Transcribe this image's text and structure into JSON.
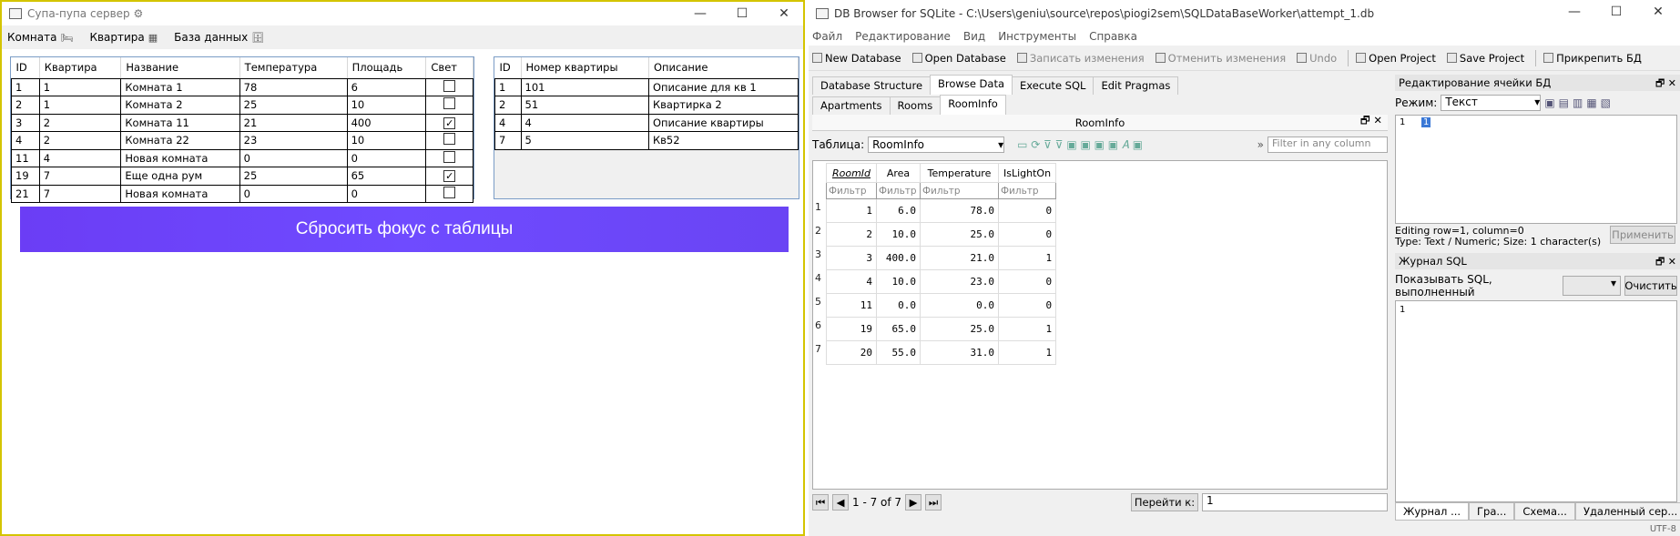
{
  "wpf": {
    "title": "Супа-пупа сервер ⚙",
    "menu": [
      {
        "label": "Комната",
        "icon": "🛏"
      },
      {
        "label": "Квартира",
        "icon": "▦"
      },
      {
        "label": "База данных",
        "icon": "🗄"
      }
    ],
    "rooms": {
      "headers": [
        "ID",
        "Квартира",
        "Название",
        "Температура",
        "Площадь",
        "Свет"
      ],
      "rows": [
        [
          "1",
          "1",
          "Комната 1",
          "78",
          "6",
          false
        ],
        [
          "2",
          "1",
          "Комната 2",
          "25",
          "10",
          false
        ],
        [
          "3",
          "2",
          "Комната 11",
          "21",
          "400",
          true
        ],
        [
          "4",
          "2",
          "Комната 22",
          "23",
          "10",
          false
        ],
        [
          "11",
          "4",
          "Новая комната",
          "0",
          "0",
          false
        ],
        [
          "19",
          "7",
          "Еще одна рум",
          "25",
          "65",
          true
        ],
        [
          "21",
          "7",
          "Новая комната",
          "0",
          "0",
          false
        ]
      ]
    },
    "apartments": {
      "headers": [
        "ID",
        "Номер квартиры",
        "Описание"
      ],
      "rows": [
        [
          "1",
          "101",
          "Описание для кв 1"
        ],
        [
          "2",
          "51",
          "Квартирка 2"
        ],
        [
          "4",
          "4",
          "Описание квартиры"
        ],
        [
          "7",
          "5",
          "Кв52"
        ]
      ]
    },
    "reset_button": "Сбросить фокус с таблицы"
  },
  "db": {
    "title": "DB Browser for SQLite - C:\\Users\\geniu\\source\\repos\\piogi2sem\\SQLDataBaseWorker\\attempt_1.db",
    "menu": [
      "Файл",
      "Редактирование",
      "Вид",
      "Инструменты",
      "Справка"
    ],
    "toolbar": [
      "New Database",
      "Open Database",
      "Записать изменения",
      "Отменить изменения",
      "Undo",
      "Open Project",
      "Save Project",
      "Прикрепить БД"
    ],
    "main_tabs": [
      "Database Structure",
      "Browse Data",
      "Execute SQL",
      "Edit Pragmas"
    ],
    "sub_tabs": [
      "Apartments",
      "Rooms",
      "RoomInfo"
    ],
    "panel_title": "RoomInfo",
    "table_label": "Таблица:",
    "table_select": "RoomInfo",
    "filter_placeholder": "Filter in any column",
    "columns": [
      "RoomId",
      "Area",
      "Temperature",
      "IsLightOn"
    ],
    "filter_text": "Фильтр",
    "rows": [
      [
        "1",
        "6.0",
        "78.0",
        "0"
      ],
      [
        "2",
        "10.0",
        "25.0",
        "0"
      ],
      [
        "3",
        "400.0",
        "21.0",
        "1"
      ],
      [
        "4",
        "10.0",
        "23.0",
        "0"
      ],
      [
        "11",
        "0.0",
        "0.0",
        "0"
      ],
      [
        "19",
        "65.0",
        "25.0",
        "1"
      ],
      [
        "20",
        "55.0",
        "31.0",
        "1"
      ]
    ],
    "row_numbers": [
      "1",
      "2",
      "3",
      "4",
      "5",
      "6",
      "7"
    ],
    "nav_range": "1 - 7 of 7",
    "goto_label": "Перейти к:",
    "goto_value": "1",
    "edit_cell": {
      "title": "Редактирование ячейки БД",
      "mode_label": "Режим:",
      "mode_value": "Текст",
      "line_no": "1",
      "cell_value": "1",
      "status1": "Editing row=1, column=0",
      "status2": "Type: Text / Numeric; Size: 1 character(s)",
      "apply": "Применить"
    },
    "sql_log": {
      "title": "Журнал SQL",
      "show_label": "Показывать SQL, выполненный",
      "clear": "Очистить",
      "line_no": "1"
    },
    "bottom_tabs": [
      "Журнал ...",
      "Гра...",
      "Схема...",
      "Удаленный сер..."
    ],
    "encoding": "UTF-8"
  }
}
